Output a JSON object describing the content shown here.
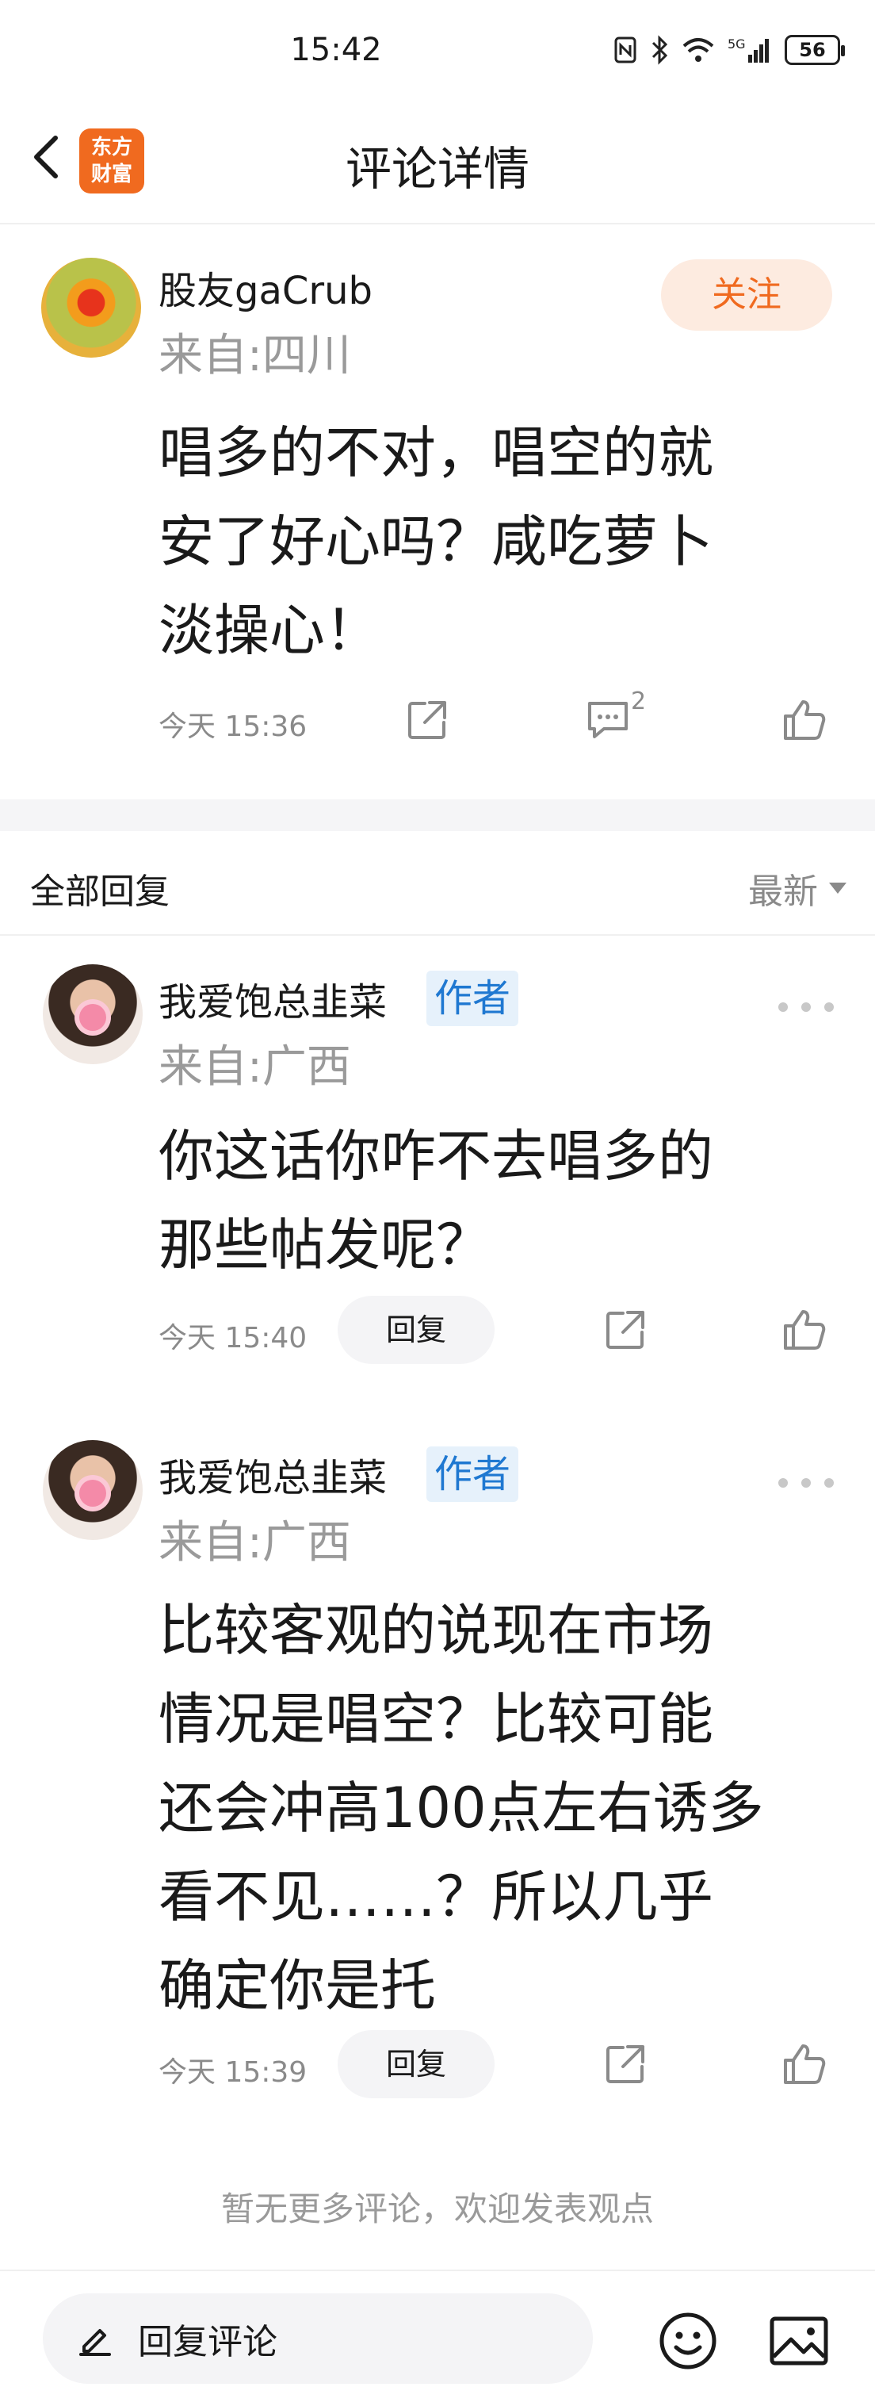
{
  "status_bar": {
    "time": "15:42",
    "battery": "56",
    "icons": [
      "nfc-icon",
      "bluetooth-icon",
      "wifi-icon",
      "5g-signal-icon",
      "battery-icon"
    ]
  },
  "nav": {
    "title": "评论详情",
    "logo_text_line1": "东方",
    "logo_text_line2": "财富",
    "brand_color": "#f06a1f"
  },
  "post": {
    "username": "股友gaCrub",
    "location": "来自:四川",
    "follow_label": "关注",
    "content_lines": [
      "唱多的不对，唱空的就",
      "安了好心吗？咸吃萝卜",
      "淡操心！"
    ],
    "time": "今天 15:36",
    "comment_count": "2"
  },
  "replies_section": {
    "title": "全部回复",
    "sort_label": "最新"
  },
  "replies": [
    {
      "username": "我爱饱总韭菜",
      "badge": "作者",
      "location": "来自:广西",
      "content_lines": [
        "你这话你咋不去唱多的",
        "那些帖发呢？"
      ],
      "time": "今天 15:40",
      "reply_label": "回复"
    },
    {
      "username": "我爱饱总韭菜",
      "badge": "作者",
      "location": "来自:广西",
      "content_lines": [
        "比较客观的说现在市场",
        "情况是唱空？比较可能",
        "还会冲高100点左右诱多",
        "看不见……？所以几乎",
        "确定你是托"
      ],
      "time": "今天 15:39",
      "reply_label": "回复"
    }
  ],
  "footer": {
    "no_more_text": "暂无更多评论，欢迎发表观点",
    "input_label": "回复评论"
  },
  "colors": {
    "badge_bg": "#e6f1fb",
    "badge_text": "#1f78d1",
    "follow_bg": "#fdebe0"
  }
}
